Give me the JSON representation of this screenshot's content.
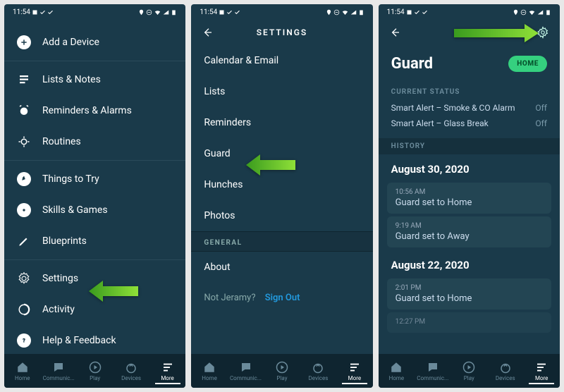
{
  "status": {
    "time": "11:54"
  },
  "screen1": {
    "menu": [
      "Add a Device",
      "Lists & Notes",
      "Reminders & Alarms",
      "Routines",
      "Things to Try",
      "Skills & Games",
      "Blueprints",
      "Settings",
      "Activity",
      "Help & Feedback"
    ]
  },
  "screen2": {
    "title": "SETTINGS",
    "items": [
      "Calendar & Email",
      "Lists",
      "Reminders",
      "Guard",
      "Hunches",
      "Photos"
    ],
    "general_label": "GENERAL",
    "general_items": [
      "About"
    ],
    "signout_prompt": "Not Jeramy?",
    "signout_link": "Sign Out"
  },
  "screen3": {
    "title": "Guard",
    "mode": "HOME",
    "status_label": "CURRENT STATUS",
    "statuses": [
      {
        "name": "Smart Alert – Smoke & CO Alarm",
        "value": "Off"
      },
      {
        "name": "Smart Alert – Glass Break",
        "value": "Off"
      }
    ],
    "history_label": "HISTORY",
    "history": [
      {
        "date": "August 30, 2020",
        "events": [
          {
            "time": "10:56 AM",
            "desc": "Guard set to Home"
          },
          {
            "time": "9:19 AM",
            "desc": "Guard set to Away"
          }
        ]
      },
      {
        "date": "August 22, 2020",
        "events": [
          {
            "time": "2:01 PM",
            "desc": "Guard set to Home"
          },
          {
            "time": "12:27 PM",
            "desc": ""
          }
        ]
      }
    ]
  },
  "nav": {
    "items": [
      "Home",
      "Communic...",
      "Play",
      "Devices",
      "More"
    ]
  }
}
